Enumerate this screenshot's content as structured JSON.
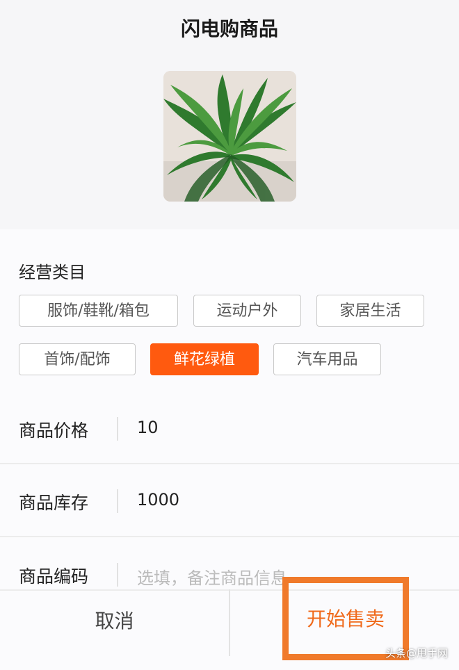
{
  "header": {
    "title": "闪电购商品"
  },
  "category": {
    "label": "经营类目",
    "options": [
      "服饰/鞋靴/箱包",
      "运动户外",
      "家居生活",
      "首饰/配饰",
      "鲜花绿植",
      "汽车用品"
    ],
    "selected": "鲜花绿植"
  },
  "fields": {
    "price": {
      "label": "商品价格",
      "value": "10"
    },
    "stock": {
      "label": "商品库存",
      "value": "1000"
    },
    "code": {
      "label": "商品编码",
      "placeholder": "选填，备注商品信息"
    }
  },
  "actions": {
    "cancel": "取消",
    "start": "开始售卖"
  },
  "colors": {
    "accent": "#ff5a0f",
    "highlight_box": "#f07a2b"
  },
  "watermark": "头条@甩手网"
}
